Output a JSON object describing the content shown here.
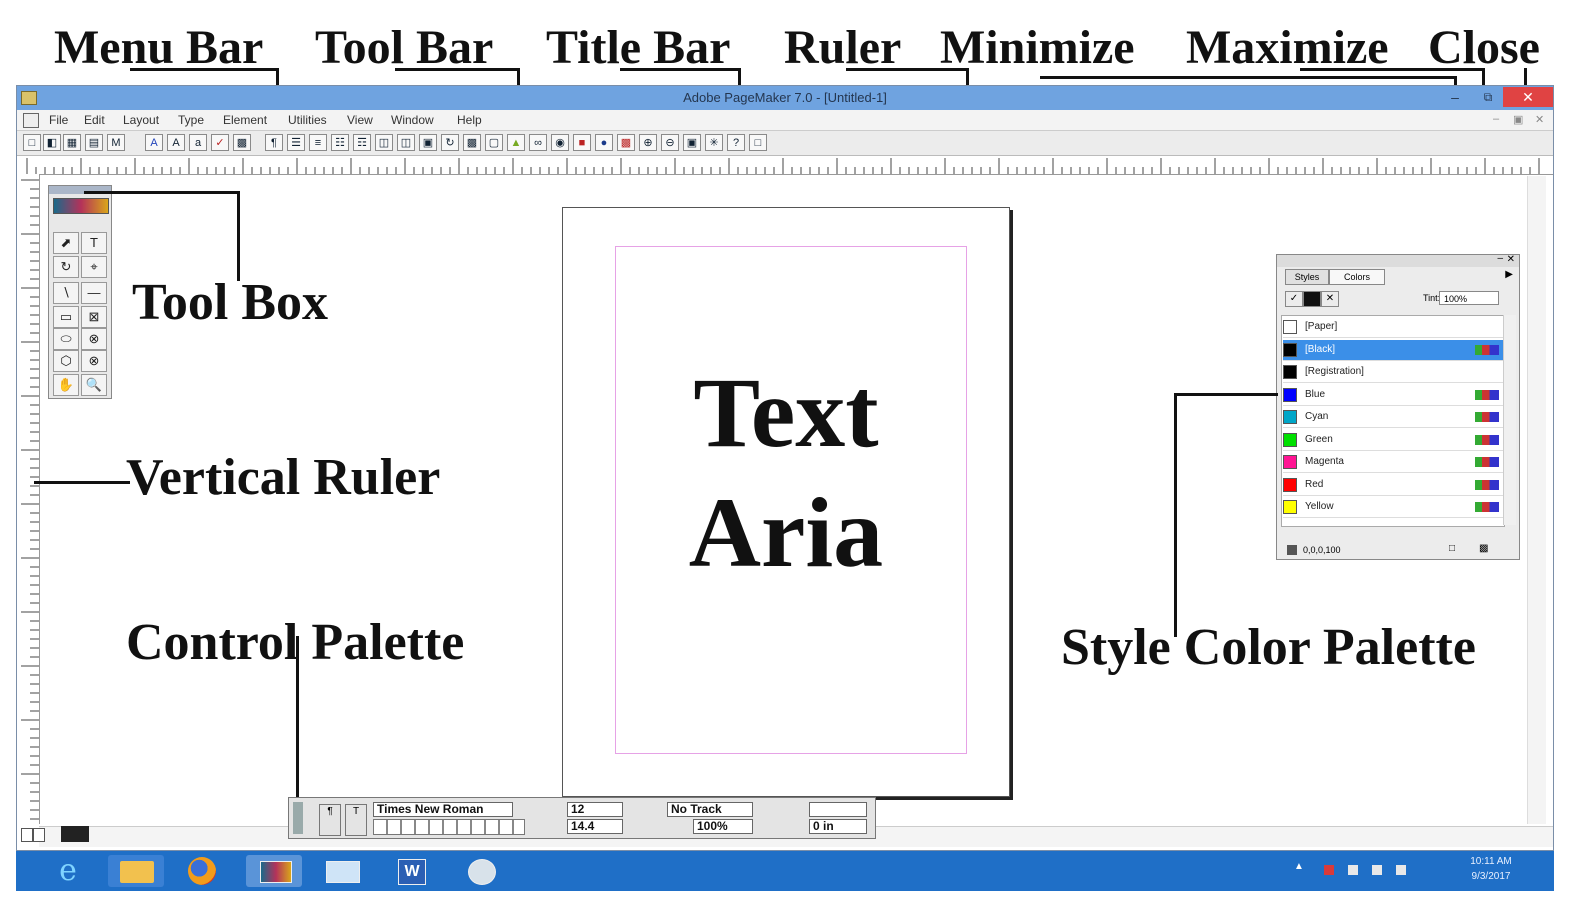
{
  "annotations": {
    "menu_bar": "Menu Bar",
    "tool_bar": "Tool Bar",
    "title_bar": "Title Bar",
    "ruler": "Ruler",
    "minimize": "Minimize",
    "maximize": "Maximize",
    "close": "Close",
    "tool_box": "Tool Box",
    "vertical_ruler": "Vertical Ruler",
    "control_palette": "Control Palette",
    "style_color_palette": "Style Color Palette"
  },
  "window": {
    "title": "Adobe PageMaker 7.0 - [Untitled-1]"
  },
  "menu": [
    "File",
    "Edit",
    "Layout",
    "Type",
    "Element",
    "Utilities",
    "View",
    "Window",
    "Help"
  ],
  "page": {
    "text_line1": "Text",
    "text_line2": "Aria"
  },
  "palette": {
    "tabs": [
      "Styles",
      "Colors"
    ],
    "tint_label": "Tint:",
    "tint_value": "100%",
    "colors": [
      {
        "name": "[Paper]",
        "hex": "#ffffff"
      },
      {
        "name": "[Black]",
        "hex": "#000000"
      },
      {
        "name": "[Registration]",
        "hex": "#000000"
      },
      {
        "name": "Blue",
        "hex": "#0000ff"
      },
      {
        "name": "Cyan",
        "hex": "#00a6c8"
      },
      {
        "name": "Green",
        "hex": "#00e000"
      },
      {
        "name": "Magenta",
        "hex": "#ff1493"
      },
      {
        "name": "Red",
        "hex": "#ff0000"
      },
      {
        "name": "Yellow",
        "hex": "#ffff00"
      }
    ],
    "footer_value": "0,0,0,100",
    "selected_color": "[Black]",
    "selection_hex": "#3b8fe8"
  },
  "control_palette": {
    "font": "Times New Roman",
    "size": "12",
    "leading": "14.4",
    "track": "No Track",
    "width": "100%",
    "indent": "0 in"
  },
  "taskbar": {
    "time": "10:11 AM",
    "date": "9/3/2017",
    "apps": [
      "internet-explorer-icon",
      "file-explorer-icon",
      "firefox-icon",
      "pagemaker-icon",
      "screenshot-icon",
      "word-icon",
      "paint-icon"
    ]
  },
  "colors": {
    "titlebar": "#6fa3e0",
    "taskbar": "#1f6fc7",
    "close_button": "#e04343"
  }
}
